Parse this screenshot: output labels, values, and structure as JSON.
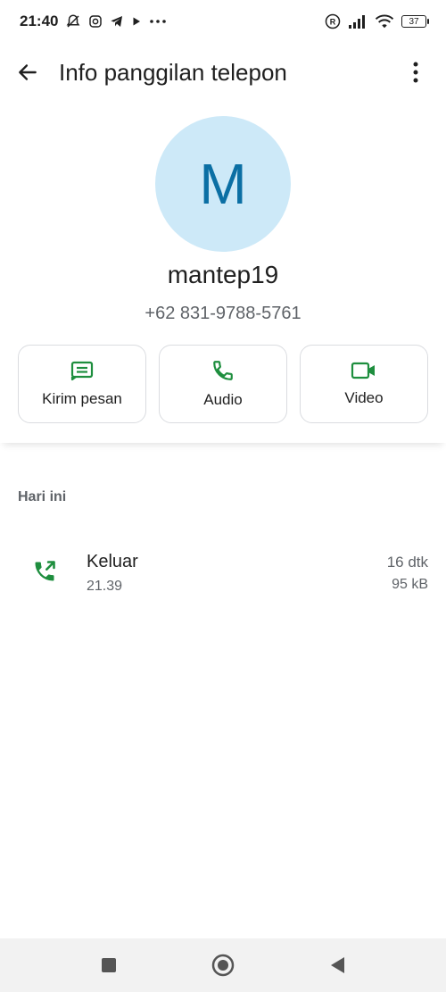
{
  "status_bar": {
    "time": "21:40",
    "battery": "37",
    "icons": [
      "muted-notification-icon",
      "instagram-icon",
      "telegram-icon",
      "play-icon",
      "more-dots-icon",
      "registered-icon",
      "signal-icon",
      "wifi-icon",
      "battery-icon"
    ]
  },
  "app_bar": {
    "title": "Info panggilan telepon",
    "back_icon": "arrow-left-icon",
    "menu_icon": "more-vertical-icon"
  },
  "contact": {
    "initial": "M",
    "name": "mantep19",
    "number": "+62 831-9788-5761",
    "avatar_color": "#cde9f8",
    "initial_color": "#0b6fa4"
  },
  "actions": [
    {
      "label": "Kirim pesan",
      "icon": "message-icon"
    },
    {
      "label": "Audio",
      "icon": "phone-icon"
    },
    {
      "label": "Video",
      "icon": "video-icon"
    }
  ],
  "accent_color": "#1e8e3e",
  "history": {
    "section_label": "Hari ini",
    "calls": [
      {
        "type": "Keluar",
        "time": "21.39",
        "duration": "16 dtk",
        "size": "95 kB",
        "icon": "outgoing-call-icon"
      }
    ]
  },
  "nav_bar": {
    "buttons": [
      "recents-square-icon",
      "home-circle-icon",
      "back-triangle-icon"
    ]
  }
}
